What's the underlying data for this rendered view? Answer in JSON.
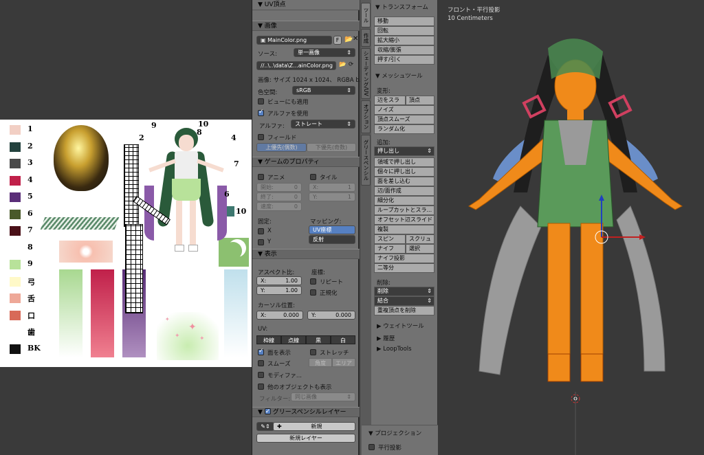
{
  "uv_editor": {
    "swatches": [
      {
        "label": "1",
        "color": "#f2cfc4"
      },
      {
        "label": "2",
        "color": "#24423e"
      },
      {
        "label": "3",
        "color": "#4a4a4a"
      },
      {
        "label": "4",
        "color": "#c0204a"
      },
      {
        "label": "5",
        "color": "#5a2e78"
      },
      {
        "label": "6",
        "color": "#4a5a2a"
      },
      {
        "label": "7",
        "color": "#4a1018"
      },
      {
        "label": "8",
        "color": "#ffffff"
      },
      {
        "label": "9",
        "color": "#b8e29a"
      },
      {
        "label": "弓",
        "color": "#fff9c8"
      },
      {
        "label": "舌",
        "color": "#eea898"
      },
      {
        "label": "口",
        "color": "#d86a58"
      },
      {
        "label": "歯",
        "color": "#ffffff"
      },
      {
        "label": "BK",
        "color": "#111111"
      }
    ],
    "callouts": [
      "9",
      "10",
      "2",
      "8",
      "4",
      "7",
      "6",
      "10"
    ]
  },
  "n_panel": {
    "top_header": "UV頂点",
    "image": {
      "header": "画像",
      "image_name": "MainColor.png",
      "fake_user": "F",
      "source_label": "ソース:",
      "source_value": "単一画像",
      "filepath": "//..\\..\\data\\Z...ainColor.png",
      "info": "画像: サイズ 1024 x 1024、 RGBA b...",
      "colorspace_label": "色空間:",
      "colorspace_value": "sRGB",
      "view_as_render": "ビューにも適用",
      "use_alpha": "アルファを使用",
      "alpha_label": "アルファ:",
      "alpha_value": "ストレート",
      "fields": "フィールド",
      "upper_first": "上優先(偶数)",
      "lower_first": "下優先(奇数)"
    },
    "game": {
      "header": "ゲームのプロパティ",
      "animation": "アニメ",
      "tiles": "タイル",
      "start": "開始:",
      "start_val": "0",
      "end": "終了:",
      "end_val": "0",
      "speed": "速度:",
      "speed_val": "0",
      "tx": "X:",
      "tx_val": "1",
      "ty": "Y:",
      "ty_val": "1",
      "clamp": "固定:",
      "mapping": "マッピング:",
      "cx": "X",
      "cy": "Y",
      "uv_coord": "UV座標",
      "reflection": "反射"
    },
    "display": {
      "header": "表示",
      "aspect": "アスペクト比:",
      "coords": "座標:",
      "ax": "X:",
      "ax_val": "1.00",
      "ay": "Y:",
      "ay_val": "1.00",
      "repeat": "リピート",
      "normalize": "正規化",
      "cursor": "カーソル位置:",
      "cx": "X:",
      "cx_val": "0.000",
      "cy": "Y:",
      "cy_val": "0.000",
      "uv": "UV:",
      "uv_modes": [
        "枠線",
        "点線",
        "黒",
        "白"
      ],
      "faces": "面を表示",
      "stretch": "ストレッチ",
      "smooth": "スムーズ",
      "angle": "角度",
      "area": "エリア",
      "modified": "モディファ...",
      "other_objects": "他のオブジェクトも表示",
      "filter_label": "フィルター:",
      "filter_value": "同じ画像"
    },
    "gp": {
      "header": "グリースペンシルレイヤー",
      "new": "新規",
      "new_layer": "新規レイヤー"
    }
  },
  "tabs": [
    "ツール",
    "作成",
    "シェーディング/UV",
    "オプション",
    "グリースペンシル"
  ],
  "tool_shelf": {
    "transform_header": "トランスフォーム",
    "transform": [
      "移動",
      "回転",
      "拡大縮小",
      "収縮/膨張",
      "押す/引く"
    ],
    "mesh_header": "メッシュツール",
    "deform_label": "変形:",
    "deform_a": "辺をスラ",
    "deform_b": "頂点",
    "noise": "ノイズ",
    "smooth_vertex": "頂点スムーズ",
    "randomize": "ランダム化",
    "add_label": "追加:",
    "extrude": "押し出し",
    "add_items": [
      "領域で押し出し",
      "個々に押し出し",
      "面を差し込む",
      "辺/面作成",
      "細分化",
      "ループカットとスラ...",
      "オフセット辺スライド",
      "複製"
    ],
    "spin": "スピン",
    "screw": "スクリュ",
    "knife": "ナイフ",
    "select": "選択",
    "knife_project": "ナイフ投影",
    "bisect": "二等分",
    "remove_label": "削除:",
    "delete": "削除",
    "merge": "結合",
    "remove_doubles": "重複頂点を削除",
    "weight_tools": "ウェイトツール",
    "history": "履歴",
    "looptools": "LoopTools",
    "projection": "プロジェクション",
    "ortho": "平行投影"
  },
  "viewport": {
    "view_name": "フロント・平行投影",
    "units": "10 Centimeters"
  }
}
